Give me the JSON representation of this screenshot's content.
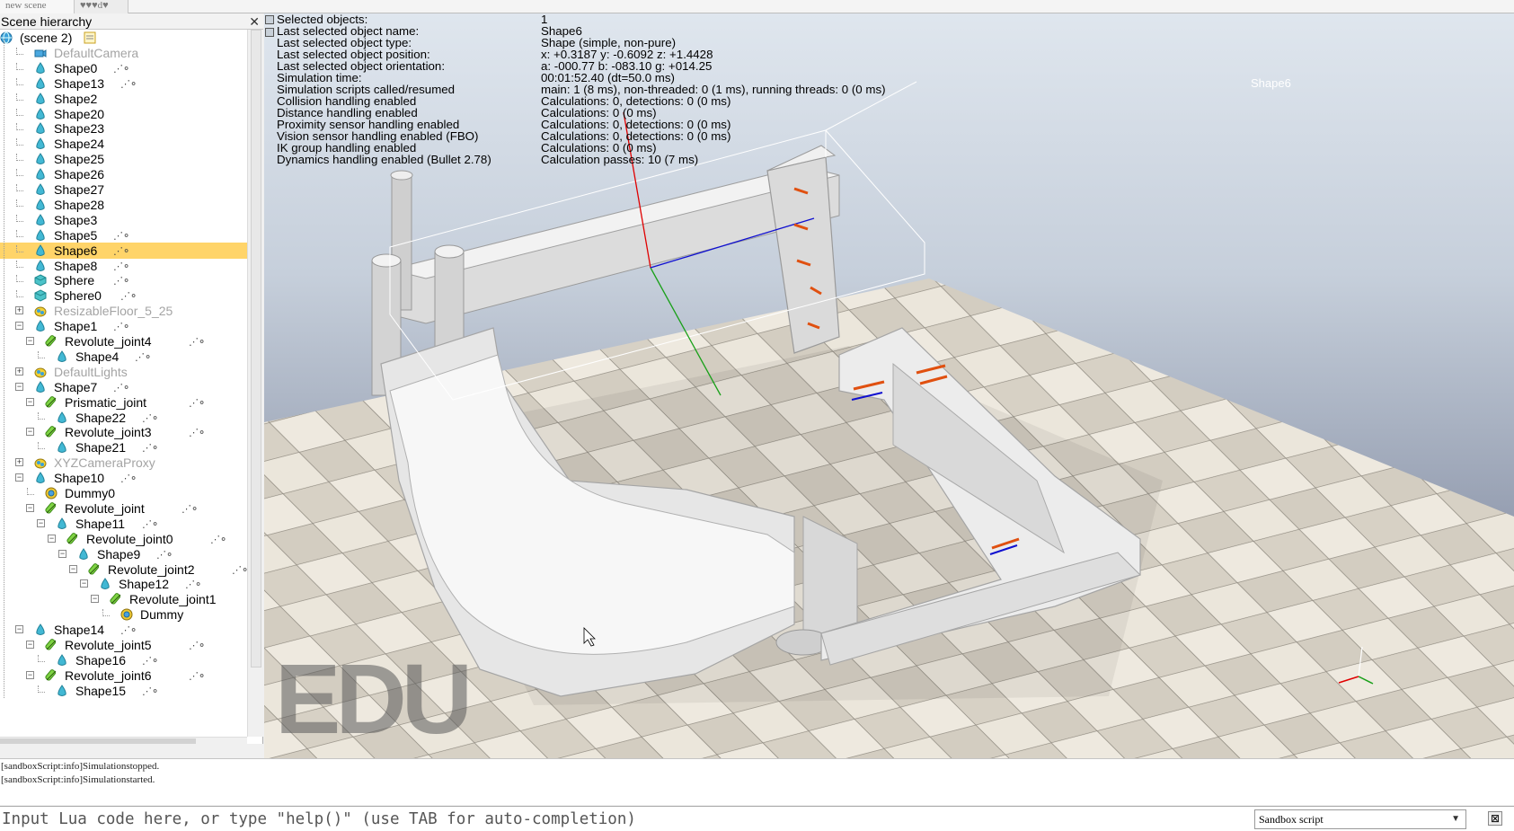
{
  "tabs": [
    "new scene",
    "♥♥♥d♥"
  ],
  "hierarchy": {
    "title": "Scene hierarchy",
    "close": "✕",
    "rows": [
      {
        "label": "(scene 2)",
        "depth": 0,
        "icon": "globe-icon",
        "exp": "",
        "dim": false,
        "scripts": false,
        "sel": false
      },
      {
        "label": "DefaultCamera",
        "depth": 1,
        "icon": "camera-icon",
        "exp": "",
        "dim": true,
        "scripts": false,
        "sel": false
      },
      {
        "label": "Shape0",
        "depth": 1,
        "icon": "shape-icon",
        "exp": "",
        "dim": false,
        "scripts": true,
        "sel": false
      },
      {
        "label": "Shape13",
        "depth": 1,
        "icon": "shape-icon",
        "exp": "",
        "dim": false,
        "scripts": true,
        "sel": false
      },
      {
        "label": "Shape2",
        "depth": 1,
        "icon": "shape-icon",
        "exp": "",
        "dim": false,
        "scripts": false,
        "sel": false
      },
      {
        "label": "Shape20",
        "depth": 1,
        "icon": "shape-icon",
        "exp": "",
        "dim": false,
        "scripts": false,
        "sel": false
      },
      {
        "label": "Shape23",
        "depth": 1,
        "icon": "shape-icon",
        "exp": "",
        "dim": false,
        "scripts": false,
        "sel": false
      },
      {
        "label": "Shape24",
        "depth": 1,
        "icon": "shape-icon",
        "exp": "",
        "dim": false,
        "scripts": false,
        "sel": false
      },
      {
        "label": "Shape25",
        "depth": 1,
        "icon": "shape-icon",
        "exp": "",
        "dim": false,
        "scripts": false,
        "sel": false
      },
      {
        "label": "Shape26",
        "depth": 1,
        "icon": "shape-icon",
        "exp": "",
        "dim": false,
        "scripts": false,
        "sel": false
      },
      {
        "label": "Shape27",
        "depth": 1,
        "icon": "shape-icon",
        "exp": "",
        "dim": false,
        "scripts": false,
        "sel": false
      },
      {
        "label": "Shape28",
        "depth": 1,
        "icon": "shape-icon",
        "exp": "",
        "dim": false,
        "scripts": false,
        "sel": false
      },
      {
        "label": "Shape3",
        "depth": 1,
        "icon": "shape-icon",
        "exp": "",
        "dim": false,
        "scripts": false,
        "sel": false
      },
      {
        "label": "Shape5",
        "depth": 1,
        "icon": "shape-icon",
        "exp": "",
        "dim": false,
        "scripts": true,
        "sel": false
      },
      {
        "label": "Shape6",
        "depth": 1,
        "icon": "shape-icon",
        "exp": "",
        "dim": false,
        "scripts": true,
        "sel": true
      },
      {
        "label": "Shape8",
        "depth": 1,
        "icon": "shape-icon",
        "exp": "",
        "dim": false,
        "scripts": true,
        "sel": false
      },
      {
        "label": "Sphere",
        "depth": 1,
        "icon": "cube-icon",
        "exp": "",
        "dim": false,
        "scripts": true,
        "sel": false
      },
      {
        "label": "Sphere0",
        "depth": 1,
        "icon": "cube-icon",
        "exp": "",
        "dim": false,
        "scripts": true,
        "sel": false
      },
      {
        "label": "ResizableFloor_5_25",
        "depth": 1,
        "icon": "model-icon",
        "exp": "+",
        "dim": true,
        "scripts": false,
        "sel": false
      },
      {
        "label": "Shape1",
        "depth": 1,
        "icon": "shape-icon",
        "exp": "−",
        "dim": false,
        "scripts": true,
        "sel": false
      },
      {
        "label": "Revolute_joint4",
        "depth": 2,
        "icon": "joint-icon",
        "exp": "−",
        "dim": false,
        "scripts": true,
        "sel": false
      },
      {
        "label": "Shape4",
        "depth": 3,
        "icon": "shape-icon",
        "exp": "",
        "dim": false,
        "scripts": true,
        "sel": false
      },
      {
        "label": "DefaultLights",
        "depth": 1,
        "icon": "model-icon",
        "exp": "+",
        "dim": true,
        "scripts": false,
        "sel": false
      },
      {
        "label": "Shape7",
        "depth": 1,
        "icon": "shape-icon",
        "exp": "−",
        "dim": false,
        "scripts": true,
        "sel": false
      },
      {
        "label": "Prismatic_joint",
        "depth": 2,
        "icon": "joint-icon",
        "exp": "−",
        "dim": false,
        "scripts": true,
        "sel": false
      },
      {
        "label": "Shape22",
        "depth": 3,
        "icon": "shape-icon",
        "exp": "",
        "dim": false,
        "scripts": true,
        "sel": false
      },
      {
        "label": "Revolute_joint3",
        "depth": 2,
        "icon": "joint-icon",
        "exp": "−",
        "dim": false,
        "scripts": true,
        "sel": false
      },
      {
        "label": "Shape21",
        "depth": 3,
        "icon": "shape-icon",
        "exp": "",
        "dim": false,
        "scripts": true,
        "sel": false
      },
      {
        "label": "XYZCameraProxy",
        "depth": 1,
        "icon": "model-icon",
        "exp": "+",
        "dim": true,
        "scripts": false,
        "sel": false
      },
      {
        "label": "Shape10",
        "depth": 1,
        "icon": "shape-icon",
        "exp": "−",
        "dim": false,
        "scripts": true,
        "sel": false
      },
      {
        "label": "Dummy0",
        "depth": 2,
        "icon": "dummy-icon",
        "exp": "",
        "dim": false,
        "scripts": false,
        "sel": false
      },
      {
        "label": "Revolute_joint",
        "depth": 2,
        "icon": "joint-icon",
        "exp": "−",
        "dim": false,
        "scripts": true,
        "sel": false
      },
      {
        "label": "Shape11",
        "depth": 3,
        "icon": "shape-icon",
        "exp": "−",
        "dim": false,
        "scripts": true,
        "sel": false
      },
      {
        "label": "Revolute_joint0",
        "depth": 4,
        "icon": "joint-icon",
        "exp": "−",
        "dim": false,
        "scripts": true,
        "sel": false
      },
      {
        "label": "Shape9",
        "depth": 5,
        "icon": "shape-icon",
        "exp": "−",
        "dim": false,
        "scripts": true,
        "sel": false
      },
      {
        "label": "Revolute_joint2",
        "depth": 6,
        "icon": "joint-icon",
        "exp": "−",
        "dim": false,
        "scripts": true,
        "sel": false
      },
      {
        "label": "Shape12",
        "depth": 7,
        "icon": "shape-icon",
        "exp": "−",
        "dim": false,
        "scripts": true,
        "sel": false
      },
      {
        "label": "Revolute_joint1",
        "depth": 8,
        "icon": "joint-icon",
        "exp": "−",
        "dim": false,
        "scripts": true,
        "sel": false
      },
      {
        "label": "Dummy",
        "depth": 9,
        "icon": "dummy-icon",
        "exp": "",
        "dim": false,
        "scripts": false,
        "sel": false
      },
      {
        "label": "Shape14",
        "depth": 1,
        "icon": "shape-icon",
        "exp": "−",
        "dim": false,
        "scripts": true,
        "sel": false
      },
      {
        "label": "Revolute_joint5",
        "depth": 2,
        "icon": "joint-icon",
        "exp": "−",
        "dim": false,
        "scripts": true,
        "sel": false
      },
      {
        "label": "Shape16",
        "depth": 3,
        "icon": "shape-icon",
        "exp": "",
        "dim": false,
        "scripts": true,
        "sel": false
      },
      {
        "label": "Revolute_joint6",
        "depth": 2,
        "icon": "joint-icon",
        "exp": "−",
        "dim": false,
        "scripts": true,
        "sel": false
      },
      {
        "label": "Shape15",
        "depth": 3,
        "icon": "shape-icon",
        "exp": "",
        "dim": false,
        "scripts": true,
        "sel": false
      }
    ]
  },
  "info": {
    "rows": [
      {
        "key": "Selected objects:",
        "value": "1"
      },
      {
        "key": "Last selected object name:",
        "value": "Shape6"
      },
      {
        "key": "Last selected object type:",
        "value": "Shape (simple, non-pure)"
      },
      {
        "key": "Last selected object position:",
        "value": "x: +0.3187    y: -0.6092    z: +1.4428"
      },
      {
        "key": "Last selected object orientation:",
        "value": "a: -000.77    b: -083.10    g: +014.25"
      },
      {
        "key": "Simulation time:",
        "value": "00:01:52.40 (dt=50.0 ms)"
      },
      {
        "key": "Simulation scripts called/resumed",
        "value": "main: 1 (8 ms), non-threaded: 0 (1 ms), running threads: 0 (0 ms)"
      },
      {
        "key": "Collision handling enabled",
        "value": "Calculations: 0, detections: 0 (0 ms)"
      },
      {
        "key": "Distance handling enabled",
        "value": "Calculations: 0 (0 ms)"
      },
      {
        "key": "Proximity sensor handling enabled",
        "value": "Calculations: 0, detections: 0 (0 ms)"
      },
      {
        "key": "Vision sensor handling enabled (FBO)",
        "value": "Calculations: 0, detections: 0 (0 ms)"
      },
      {
        "key": "IK group handling enabled",
        "value": "Calculations: 0 (0 ms)"
      },
      {
        "key": "Dynamics handling enabled (Bullet 2.78)",
        "value": "Calculation passes: 10 (7 ms)"
      }
    ],
    "selected_tag": "Shape6",
    "watermark": "EDU"
  },
  "colors": {
    "selection": "#ffd469",
    "x_axis": "#e00000",
    "y_axis": "#1aa01a",
    "z_axis": "#1010d0",
    "floor_light": "#ece7dc",
    "floor_dark": "#cfc9bd",
    "part_white": "#f4f4f4"
  },
  "console": {
    "lines": [
      "[sandboxScript:info]Simulationstopped.",
      "[sandboxScript:info]Simulationstarted."
    ]
  },
  "input": {
    "placeholder": "Input Lua code here, or type \"help()\" (use TAB for auto-completion)",
    "script_selector": "Sandbox script",
    "close": "⊠"
  }
}
